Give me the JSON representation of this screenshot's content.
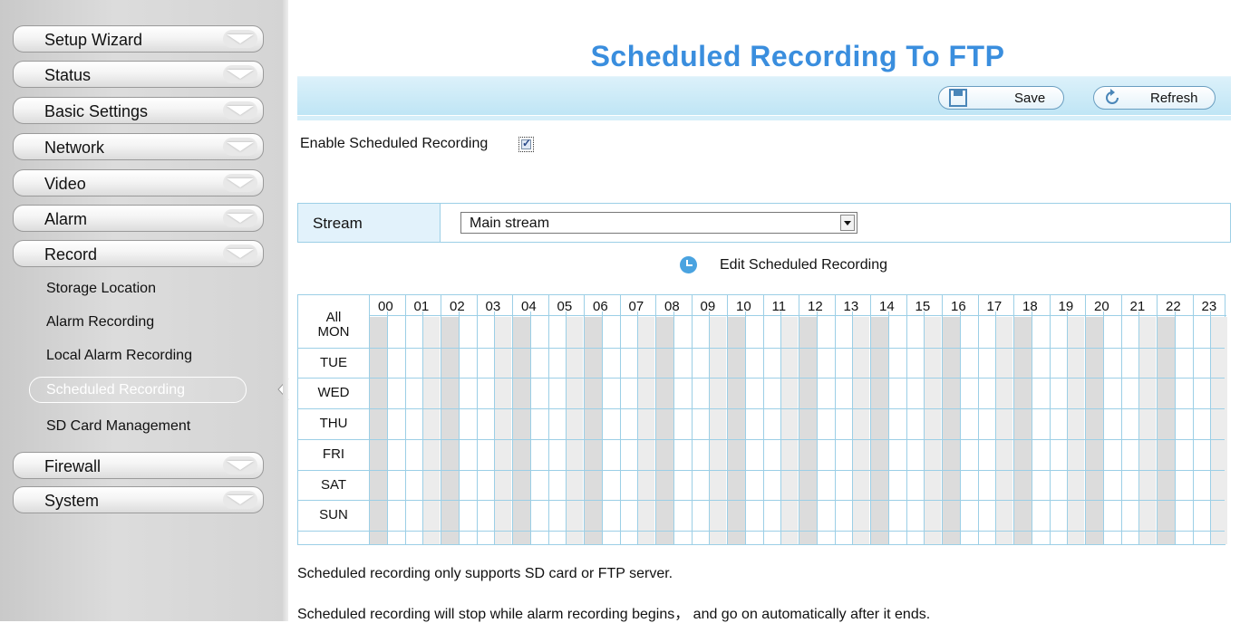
{
  "sidebar": {
    "menu_top": [
      {
        "label": "Setup Wizard"
      },
      {
        "label": "Status"
      },
      {
        "label": "Basic Settings"
      },
      {
        "label": "Network"
      },
      {
        "label": "Video"
      },
      {
        "label": "Alarm"
      },
      {
        "label": "Record"
      }
    ],
    "record_sub": [
      {
        "label": "Storage Location"
      },
      {
        "label": "Alarm Recording"
      },
      {
        "label": "Local Alarm Recording"
      },
      {
        "label": "Scheduled Recording",
        "active": true
      },
      {
        "label": "SD Card Management"
      }
    ],
    "menu_bottom": [
      {
        "label": "Firewall"
      },
      {
        "label": "System"
      }
    ]
  },
  "main": {
    "title": "Scheduled Recording To FTP",
    "toolbar": {
      "save_label": "Save",
      "refresh_label": "Refresh"
    },
    "enable_label": "Enable Scheduled Recording",
    "enable_checked": true,
    "stream": {
      "label": "Stream",
      "selected": "Main stream"
    },
    "edit_schedule_label": "Edit Scheduled Recording",
    "schedule": {
      "all_label": "All",
      "hours": [
        "00",
        "01",
        "02",
        "03",
        "04",
        "05",
        "06",
        "07",
        "08",
        "09",
        "10",
        "11",
        "12",
        "13",
        "14",
        "15",
        "16",
        "17",
        "18",
        "19",
        "20",
        "21",
        "22",
        "23"
      ],
      "days": [
        "MON",
        "TUE",
        "WED",
        "THU",
        "FRI",
        "SAT",
        "SUN"
      ]
    },
    "notes": [
      "Scheduled recording only supports SD card or FTP server.",
      "Scheduled recording will stop while alarm recording begins， and go on automatically after it ends."
    ]
  },
  "colors": {
    "title": "#3a8ede",
    "toolbar": "#bfe5f5",
    "grid_border": "#9ccfe6",
    "grid_shade": "#dcdcdc"
  }
}
